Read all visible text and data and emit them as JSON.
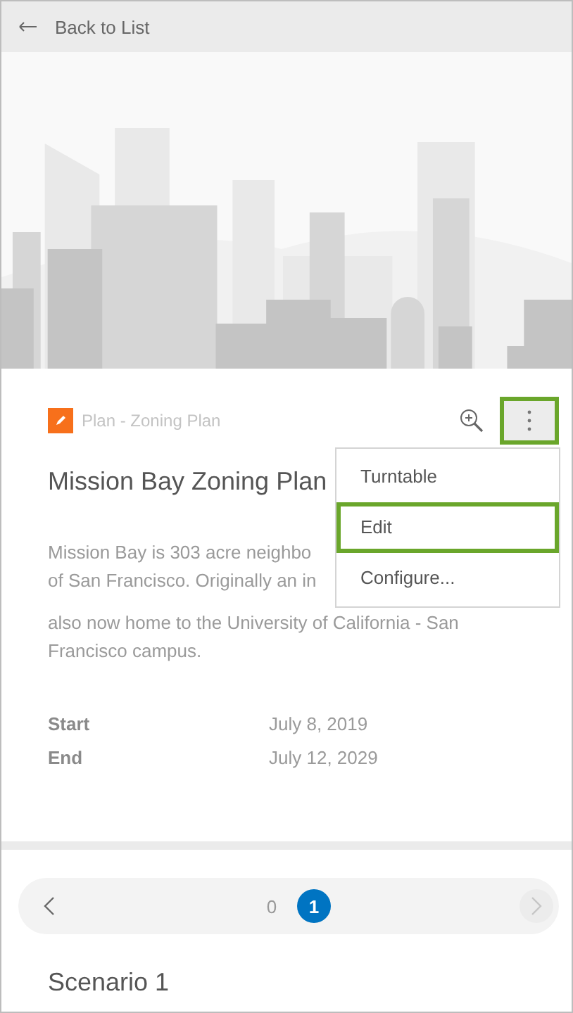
{
  "header": {
    "back_label": "Back to List"
  },
  "item": {
    "type_label": "Plan - Zoning Plan",
    "title": "Mission Bay Zoning Plan",
    "description_lines": [
      "Mission Bay is 303 acre neighbo",
      "of San Francisco. Originally an in",
      "also now home to the University of California - San",
      "Francisco campus."
    ],
    "fields": [
      {
        "label": "Start",
        "value": "July 8, 2019"
      },
      {
        "label": "End",
        "value": "July 12, 2029"
      }
    ]
  },
  "more_button": {
    "highlighted": true
  },
  "more_menu": {
    "open": true,
    "items": [
      {
        "label": "Turntable",
        "highlighted": false
      },
      {
        "label": "Edit",
        "highlighted": true
      },
      {
        "label": "Configure...",
        "highlighted": false
      }
    ]
  },
  "scenario_pager": {
    "prev_disabled": false,
    "next_disabled": true,
    "pages": [
      {
        "label": "0",
        "selected": false
      },
      {
        "label": "1",
        "selected": true
      }
    ]
  },
  "scenario": {
    "title": "Scenario 1"
  }
}
